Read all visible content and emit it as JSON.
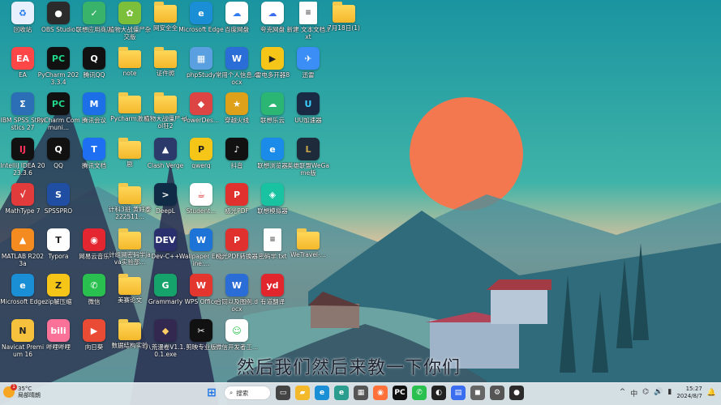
{
  "desktop_icons": [
    {
      "label": "回收站",
      "glyph": "♻",
      "color": "#e8f0fe",
      "fg": "#1a73e8",
      "col": 0,
      "row": 0,
      "icon": "recycle-bin-icon"
    },
    {
      "label": "OBS Studio",
      "glyph": "●",
      "color": "#2b2b2b",
      "fg": "#fff",
      "col": 1,
      "row": 0,
      "icon": "obs-icon"
    },
    {
      "label": "联想应用商店",
      "glyph": "✓",
      "color": "#3ab36a",
      "fg": "#fff",
      "col": 2,
      "row": 0,
      "icon": "lenovo-store-icon"
    },
    {
      "label": "植物大战僵尸杂交版",
      "glyph": "✿",
      "color": "#7bbf3a",
      "fg": "#fff",
      "col": 3,
      "row": 0,
      "icon": "pvz-icon"
    },
    {
      "label": "网安全全",
      "glyph": "",
      "color": "folder",
      "fg": "#fff",
      "col": 4,
      "row": 0,
      "icon": "folder-icon"
    },
    {
      "label": "Microsoft Edge",
      "glyph": "e",
      "color": "#1b8fd6",
      "fg": "#fff",
      "col": 5,
      "row": 0,
      "icon": "edge-icon"
    },
    {
      "label": "百度网盘",
      "glyph": "☁",
      "color": "#ffffff",
      "fg": "#2f7ef5",
      "col": 6,
      "row": 0,
      "icon": "baidu-netdisk-icon"
    },
    {
      "label": "夸克网盘",
      "glyph": "☁",
      "color": "#ffffff",
      "fg": "#3a6df0",
      "col": 7,
      "row": 0,
      "icon": "quark-netdisk-icon"
    },
    {
      "label": "新建 文本文档.txt",
      "glyph": "≡",
      "color": "doc",
      "fg": "#555",
      "col": 8,
      "row": 0,
      "icon": "text-file-icon"
    },
    {
      "label": "7月18日(1)",
      "glyph": "",
      "color": "folder",
      "fg": "#fff",
      "col": 9,
      "row": 0,
      "icon": "folder-icon"
    },
    {
      "label": "EA",
      "glyph": "EA",
      "color": "#ff4747",
      "fg": "#fff",
      "col": 0,
      "row": 1,
      "icon": "ea-icon"
    },
    {
      "label": "PyCharm 2023.3.4",
      "glyph": "PC",
      "color": "#111",
      "fg": "#21d789",
      "col": 1,
      "row": 1,
      "icon": "pycharm-icon"
    },
    {
      "label": "腾讯QQ",
      "glyph": "Q",
      "color": "#111",
      "fg": "#fff",
      "col": 2,
      "row": 1,
      "icon": "qq-icon"
    },
    {
      "label": "note",
      "glyph": "",
      "color": "folder",
      "fg": "#fff",
      "col": 3,
      "row": 1,
      "icon": "folder-icon"
    },
    {
      "label": "证件照",
      "glyph": "",
      "color": "folder",
      "fg": "#fff",
      "col": 4,
      "row": 1,
      "icon": "folder-icon"
    },
    {
      "label": "phpStudy",
      "glyph": "▦",
      "color": "#5aa0e0",
      "fg": "#fff",
      "col": 5,
      "row": 1,
      "icon": "phpstudy-icon"
    },
    {
      "label": "常用个人信息.docx",
      "glyph": "W",
      "color": "#2b6dd6",
      "fg": "#fff",
      "col": 6,
      "row": 1,
      "icon": "word-doc-icon"
    },
    {
      "label": "雷电多开器8",
      "glyph": "▶",
      "color": "#f5c518",
      "fg": "#222",
      "col": 7,
      "row": 1,
      "icon": "ldplayer-icon"
    },
    {
      "label": "迅雷",
      "glyph": "✈",
      "color": "#3a8ef6",
      "fg": "#fff",
      "col": 8,
      "row": 1,
      "icon": "thunder-icon"
    },
    {
      "label": "IBM SPSS Statistics 27",
      "glyph": "Σ",
      "color": "#2d6fb7",
      "fg": "#fff",
      "col": 0,
      "row": 2,
      "icon": "spss-icon"
    },
    {
      "label": "PyCharm Communi...",
      "glyph": "PC",
      "color": "#111",
      "fg": "#21d789",
      "col": 1,
      "row": 2,
      "icon": "pycharm-ce-icon"
    },
    {
      "label": "腾讯会议",
      "glyph": "M",
      "color": "#1d6fe8",
      "fg": "#fff",
      "col": 2,
      "row": 2,
      "icon": "tencent-meeting-icon"
    },
    {
      "label": "Pycharm激活",
      "glyph": "",
      "color": "folder",
      "fg": "#fff",
      "col": 3,
      "row": 2,
      "icon": "folder-icon"
    },
    {
      "label": "植物大战僵尸+lol狂2",
      "glyph": "",
      "color": "folder",
      "fg": "#fff",
      "col": 4,
      "row": 2,
      "icon": "folder-icon"
    },
    {
      "label": "PowerDes...",
      "glyph": "◆",
      "color": "#d44",
      "fg": "#fff",
      "col": 5,
      "row": 2,
      "icon": "powerdesigner-icon"
    },
    {
      "label": "穿越火线",
      "glyph": "★",
      "color": "#e0a11a",
      "fg": "#fff",
      "col": 6,
      "row": 2,
      "icon": "crossfire-icon"
    },
    {
      "label": "联想乐云",
      "glyph": "☁",
      "color": "#2bb673",
      "fg": "#fff",
      "col": 7,
      "row": 2,
      "icon": "lenovo-cloud-icon"
    },
    {
      "label": "UU加速器",
      "glyph": "U",
      "color": "#1a2a44",
      "fg": "#3ad1ff",
      "col": 8,
      "row": 2,
      "icon": "uu-accelerator-icon"
    },
    {
      "label": "IntelliJ IDEA 2023.3.6",
      "glyph": "IJ",
      "color": "#111",
      "fg": "#fe315d",
      "col": 0,
      "row": 3,
      "icon": "intellij-icon"
    },
    {
      "label": "QQ",
      "glyph": "Q",
      "color": "#111",
      "fg": "#fff",
      "col": 1,
      "row": 3,
      "icon": "qq2-icon"
    },
    {
      "label": "腾讯文档",
      "glyph": "T",
      "color": "#1e6ff1",
      "fg": "#fff",
      "col": 2,
      "row": 3,
      "icon": "tencent-docs-icon"
    },
    {
      "label": "剧",
      "glyph": "",
      "color": "folder",
      "fg": "#fff",
      "col": 3,
      "row": 3,
      "icon": "folder-icon"
    },
    {
      "label": "Clash Verge",
      "glyph": "▲",
      "color": "#2b3a6b",
      "fg": "#fff",
      "col": 4,
      "row": 3,
      "icon": "clash-verge-icon"
    },
    {
      "label": "qwerq",
      "glyph": "P",
      "color": "#f5c518",
      "fg": "#222",
      "col": 5,
      "row": 3,
      "icon": "qwerq-icon"
    },
    {
      "label": "抖音",
      "glyph": "♪",
      "color": "#111",
      "fg": "#fff",
      "col": 6,
      "row": 3,
      "icon": "douyin-icon"
    },
    {
      "label": "联想浏览器",
      "glyph": "e",
      "color": "#1a8be8",
      "fg": "#fff",
      "col": 7,
      "row": 3,
      "icon": "lenovo-browser-icon"
    },
    {
      "label": "英雄联盟WeGame版",
      "glyph": "L",
      "color": "#1d2b3a",
      "fg": "#c9a64b",
      "col": 8,
      "row": 3,
      "icon": "lol-icon"
    },
    {
      "label": "MathType 7",
      "glyph": "√",
      "color": "#e23b3b",
      "fg": "#fff",
      "col": 0,
      "row": 4,
      "icon": "mathtype-icon"
    },
    {
      "label": "SPSSPRO",
      "glyph": "S",
      "color": "#1f4ea3",
      "fg": "#fff",
      "col": 1,
      "row": 4,
      "icon": "spsspro-icon"
    },
    {
      "label": "计科3班 黄好泰 222511...",
      "glyph": "",
      "color": "folder",
      "fg": "#fff",
      "col": 3,
      "row": 4,
      "icon": "folder-icon"
    },
    {
      "label": "DeepL",
      "glyph": ">",
      "color": "#0f2b46",
      "fg": "#fff",
      "col": 4,
      "row": 4,
      "icon": "deepl-icon"
    },
    {
      "label": "Student...",
      "glyph": "☕",
      "color": "#ffffff",
      "fg": "#d33",
      "col": 5,
      "row": 4,
      "icon": "java-file-icon"
    },
    {
      "label": "极光PDF",
      "glyph": "P",
      "color": "#e0312f",
      "fg": "#fff",
      "col": 6,
      "row": 4,
      "icon": "jiguang-pdf-icon"
    },
    {
      "label": "联想模拟器",
      "glyph": "◈",
      "color": "#19c2a0",
      "fg": "#fff",
      "col": 7,
      "row": 4,
      "icon": "lenovo-emulator-icon"
    },
    {
      "label": "MATLAB R2023a",
      "glyph": "▲",
      "color": "#f38b20",
      "fg": "#fff",
      "col": 0,
      "row": 5,
      "icon": "matlab-icon"
    },
    {
      "label": "Typora",
      "glyph": "T",
      "color": "#ffffff",
      "fg": "#222",
      "col": 1,
      "row": 5,
      "icon": "typora-icon"
    },
    {
      "label": "网易云音乐",
      "glyph": "◉",
      "color": "#e3262f",
      "fg": "#fff",
      "col": 2,
      "row": 5,
      "icon": "netease-music-icon"
    },
    {
      "label": "计组网密码学java实验部...",
      "glyph": "",
      "color": "folder",
      "fg": "#fff",
      "col": 3,
      "row": 5,
      "icon": "folder-icon"
    },
    {
      "label": "Dev-C++",
      "glyph": "DEV",
      "color": "#2a2f6e",
      "fg": "#fff",
      "col": 4,
      "row": 5,
      "icon": "devcpp-icon"
    },
    {
      "label": "Wallpaper Engine:...",
      "glyph": "W",
      "color": "#1d73d6",
      "fg": "#fff",
      "col": 5,
      "row": 5,
      "icon": "wallpaper-engine-icon"
    },
    {
      "label": "极光PDF转换器",
      "glyph": "P",
      "color": "#e0312f",
      "fg": "#fff",
      "col": 6,
      "row": 5,
      "icon": "jiguang-pdf-converter-icon"
    },
    {
      "label": "密码学.txt",
      "glyph": "≡",
      "color": "doc",
      "fg": "#555",
      "col": 7,
      "row": 5,
      "icon": "text-file-icon"
    },
    {
      "label": "WeTravel-...",
      "glyph": "",
      "color": "folder",
      "fg": "#fff",
      "col": 8,
      "row": 5,
      "icon": "folder-icon"
    },
    {
      "label": "Microsoft Edge",
      "glyph": "e",
      "color": "#1b8fd6",
      "fg": "#fff",
      "col": 0,
      "row": 6,
      "icon": "edge2-icon"
    },
    {
      "label": "zip解压缩",
      "glyph": "Z",
      "color": "#f5c518",
      "fg": "#222",
      "col": 1,
      "row": 6,
      "icon": "zip-icon"
    },
    {
      "label": "微信",
      "glyph": "✆",
      "color": "#2ac04f",
      "fg": "#fff",
      "col": 2,
      "row": 6,
      "icon": "wechat-icon"
    },
    {
      "label": "美赛论文",
      "glyph": "",
      "color": "folder",
      "fg": "#fff",
      "col": 3,
      "row": 6,
      "icon": "folder-icon"
    },
    {
      "label": "Grammarly",
      "glyph": "G",
      "color": "#15a36b",
      "fg": "#fff",
      "col": 4,
      "row": 6,
      "icon": "grammarly-icon"
    },
    {
      "label": "WPS Office",
      "glyph": "W",
      "color": "#e2362f",
      "fg": "#fff",
      "col": 5,
      "row": 6,
      "icon": "wps-icon"
    },
    {
      "label": "合同以及图例.docx",
      "glyph": "W",
      "color": "#2b6dd6",
      "fg": "#fff",
      "col": 6,
      "row": 6,
      "icon": "word-doc2-icon"
    },
    {
      "label": "有道翻译",
      "glyph": "yd",
      "color": "#e1262d",
      "fg": "#fff",
      "col": 7,
      "row": 6,
      "icon": "youdao-icon"
    },
    {
      "label": "Navicat Premium 16",
      "glyph": "N",
      "color": "#f6c23e",
      "fg": "#222",
      "col": 0,
      "row": 7,
      "icon": "navicat-icon"
    },
    {
      "label": "哔哩哔哩",
      "glyph": "bili",
      "color": "#fb7299",
      "fg": "#fff",
      "col": 1,
      "row": 7,
      "icon": "bilibili-icon"
    },
    {
      "label": "向日葵",
      "glyph": "▶",
      "color": "#e94b35",
      "fg": "#fff",
      "col": 2,
      "row": 7,
      "icon": "sunlogin-icon"
    },
    {
      "label": "数据结构实验",
      "glyph": "",
      "color": "folder",
      "fg": "#fff",
      "col": 3,
      "row": 7,
      "icon": "folder-icon"
    },
    {
      "label": "八荒漫卷V1.1.0.1.exe",
      "glyph": "◆",
      "color": "#33284f",
      "fg": "#ffcc66",
      "col": 4,
      "row": 7,
      "icon": "game-exe-icon"
    },
    {
      "label": "剪映专业版",
      "glyph": "✂",
      "color": "#111",
      "fg": "#fff",
      "col": 5,
      "row": 7,
      "icon": "capcut-icon"
    },
    {
      "label": "微信开发者工...",
      "glyph": "☺",
      "color": "#ffffff",
      "fg": "#2ac04f",
      "col": 6,
      "row": 7,
      "icon": "wechat-devtools-icon"
    }
  ],
  "subtitle": "然后我们然后来教一下你们",
  "taskbar": {
    "weather_temp": "35°C",
    "weather_desc": "局部晴朗",
    "weather_badge": "1",
    "search_label": "搜索",
    "clock_time": "15:27",
    "clock_date": "2024/8/7",
    "pinned": [
      {
        "name": "start-button",
        "glyph": "⊞",
        "color": "#1a73e8"
      },
      {
        "name": "task-view-button",
        "glyph": "▭",
        "color": "#444"
      },
      {
        "name": "file-explorer-button",
        "glyph": "▰",
        "color": "#f4b82b"
      },
      {
        "name": "edge-taskbar-button",
        "glyph": "e",
        "color": "#1b8fd6"
      },
      {
        "name": "edge-dev-taskbar-button",
        "glyph": "e",
        "color": "#2a9d8f"
      },
      {
        "name": "store-taskbar-button",
        "glyph": "▦",
        "color": "#555"
      },
      {
        "name": "firefox-taskbar-button",
        "glyph": "◉",
        "color": "#ff7139"
      },
      {
        "name": "pycharm-taskbar-button",
        "glyph": "PC",
        "color": "#111"
      },
      {
        "name": "wechat-taskbar-button",
        "glyph": "✆",
        "color": "#2ac04f"
      },
      {
        "name": "github-taskbar-button",
        "glyph": "◐",
        "color": "#222"
      },
      {
        "name": "remote-taskbar-button",
        "glyph": "▤",
        "color": "#3a6df0"
      },
      {
        "name": "media-taskbar-button",
        "glyph": "◼",
        "color": "#666"
      },
      {
        "name": "settings-taskbar-button",
        "glyph": "⚙",
        "color": "#555"
      },
      {
        "name": "obs-taskbar-button",
        "glyph": "●",
        "color": "#2b2b2b"
      }
    ],
    "tray_icons": [
      "^",
      "中",
      "⌬",
      "🔊",
      "▮"
    ]
  }
}
